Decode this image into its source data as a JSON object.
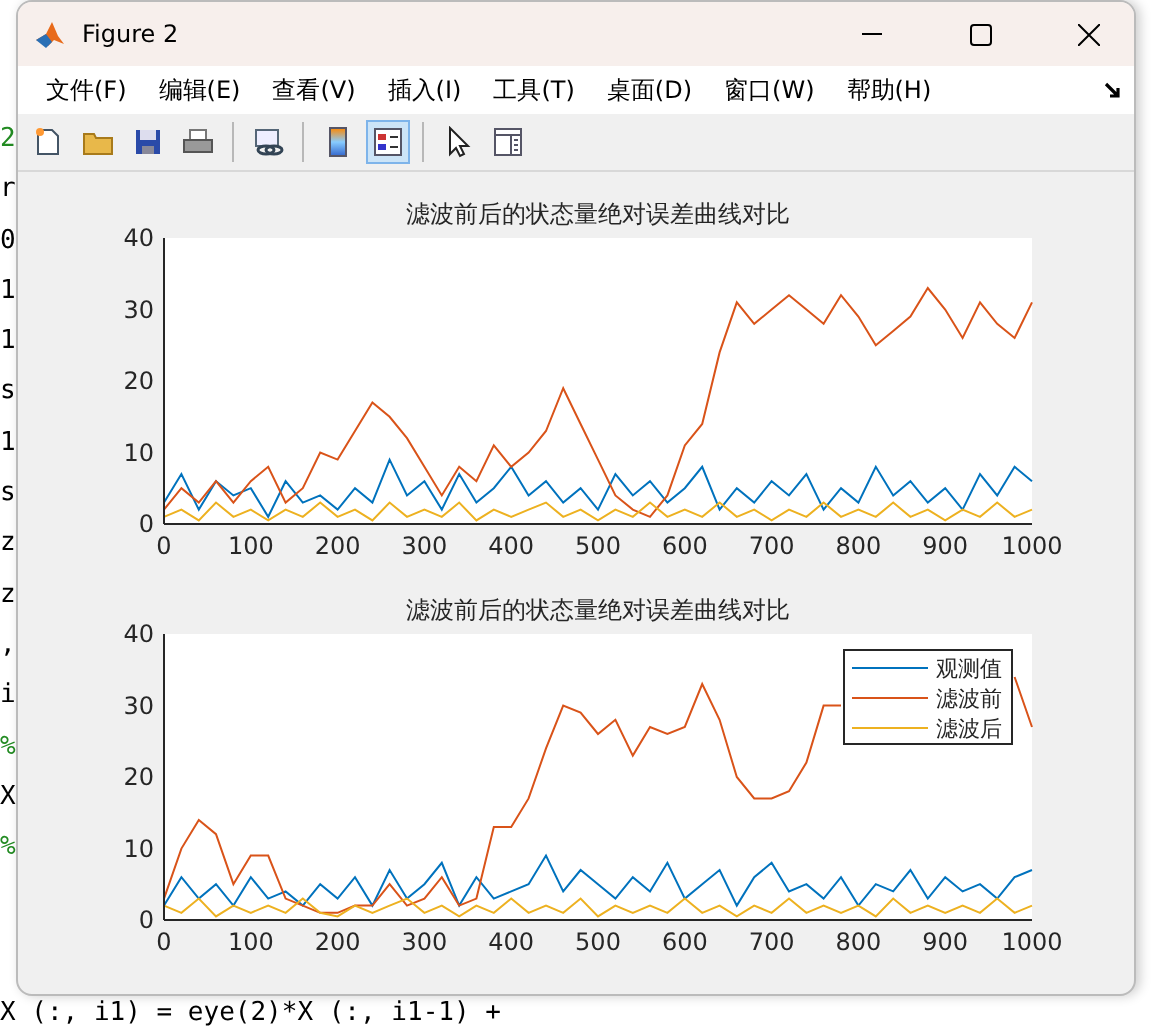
{
  "background_editor": {
    "left_lines": [
      {
        "text": "2",
        "kind": "comment"
      },
      {
        "text": "r",
        "kind": "code"
      },
      {
        "text": "0",
        "kind": "code"
      },
      {
        "text": "1",
        "kind": "code"
      },
      {
        "text": "1",
        "kind": "code"
      },
      {
        "text": "s",
        "kind": "code"
      },
      {
        "text": "1",
        "kind": "code"
      },
      {
        "text": "s",
        "kind": "code"
      },
      {
        "text": "z",
        "kind": "code"
      },
      {
        "text": "z",
        "kind": "code"
      },
      {
        "text": ",",
        "kind": "code"
      },
      {
        "text": "i",
        "kind": "code"
      },
      {
        "text": "%",
        "kind": "comment"
      },
      {
        "text": "X",
        "kind": "code"
      },
      {
        "text": "%",
        "kind": "comment"
      }
    ],
    "bottom_line": "X (:, i1) = eye(2)*X (:, i1-1) +"
  },
  "window": {
    "title": "Figure 2"
  },
  "menu": [
    "文件(F)",
    "编辑(E)",
    "查看(V)",
    "插入(I)",
    "工具(T)",
    "桌面(D)",
    "窗口(W)",
    "帮助(H)"
  ],
  "toolbar_buttons": [
    {
      "on": false
    },
    {
      "on": false
    },
    {
      "on": false
    },
    {
      "on": false
    },
    {
      "on": false
    },
    {
      "on": false
    },
    {
      "on": true
    },
    {
      "on": false
    },
    {
      "on": false
    }
  ],
  "axes": [
    {
      "chart_data": {
        "type": "line",
        "title": "滤波前后的状态量绝对误差曲线对比",
        "x": [
          0,
          20,
          40,
          60,
          80,
          100,
          120,
          140,
          160,
          180,
          200,
          220,
          240,
          260,
          280,
          300,
          320,
          340,
          360,
          380,
          400,
          420,
          440,
          460,
          480,
          500,
          520,
          540,
          560,
          580,
          600,
          620,
          640,
          660,
          680,
          700,
          720,
          740,
          760,
          780,
          800,
          820,
          840,
          860,
          880,
          900,
          920,
          940,
          960,
          980,
          1000
        ],
        "xlim": [
          0,
          1000
        ],
        "ylim": [
          0,
          40
        ],
        "xticks": [
          0,
          100,
          200,
          300,
          400,
          500,
          600,
          700,
          800,
          900,
          1000
        ],
        "yticks": [
          0,
          10,
          20,
          30,
          40
        ],
        "series": [
          {
            "color": "#0072bd",
            "values": [
              3,
              7,
              2,
              6,
              4,
              5,
              1,
              6,
              3,
              4,
              2,
              5,
              3,
              9,
              4,
              6,
              2,
              7,
              3,
              5,
              8,
              4,
              6,
              3,
              5,
              2,
              7,
              4,
              6,
              3,
              5,
              8,
              2,
              5,
              3,
              6,
              4,
              7,
              2,
              5,
              3,
              8,
              4,
              6,
              3,
              5,
              2,
              7,
              4,
              8,
              6
            ]
          },
          {
            "color": "#d95319",
            "values": [
              2,
              5,
              3,
              6,
              3,
              6,
              8,
              3,
              5,
              10,
              9,
              13,
              17,
              15,
              12,
              8,
              4,
              8,
              6,
              11,
              8,
              10,
              13,
              19,
              14,
              9,
              4,
              2,
              1,
              4,
              11,
              14,
              24,
              31,
              28,
              30,
              32,
              30,
              28,
              32,
              29,
              25,
              27,
              29,
              33,
              30,
              26,
              31,
              28,
              26,
              31
            ]
          },
          {
            "color": "#edb120",
            "values": [
              1,
              2,
              0.5,
              3,
              1,
              2,
              0.5,
              2,
              1,
              3,
              1,
              2,
              0.5,
              3,
              1,
              2,
              1,
              3,
              0.5,
              2,
              1,
              2,
              3,
              1,
              2,
              0.5,
              2,
              1,
              3,
              1,
              2,
              1,
              3,
              1,
              2,
              0.5,
              2,
              1,
              3,
              1,
              2,
              1,
              3,
              1,
              2,
              0.5,
              2,
              1,
              3,
              1,
              2
            ]
          }
        ]
      }
    },
    {
      "chart_data": {
        "type": "line",
        "title": "滤波前后的状态量绝对误差曲线对比",
        "legend": "upper right",
        "x": [
          0,
          20,
          40,
          60,
          80,
          100,
          120,
          140,
          160,
          180,
          200,
          220,
          240,
          260,
          280,
          300,
          320,
          340,
          360,
          380,
          400,
          420,
          440,
          460,
          480,
          500,
          520,
          540,
          560,
          580,
          600,
          620,
          640,
          660,
          680,
          700,
          720,
          740,
          760,
          780,
          800,
          820,
          840,
          860,
          880,
          900,
          920,
          940,
          960,
          980,
          1000
        ],
        "xlim": [
          0,
          1000
        ],
        "ylim": [
          0,
          40
        ],
        "xticks": [
          0,
          100,
          200,
          300,
          400,
          500,
          600,
          700,
          800,
          900,
          1000
        ],
        "yticks": [
          0,
          10,
          20,
          30,
          40
        ],
        "series": [
          {
            "name": "观测值",
            "color": "#0072bd",
            "values": [
              2,
              6,
              3,
              5,
              2,
              6,
              3,
              4,
              2,
              5,
              3,
              6,
              2,
              7,
              3,
              5,
              8,
              2,
              6,
              3,
              4,
              5,
              9,
              4,
              7,
              5,
              3,
              6,
              4,
              8,
              3,
              5,
              7,
              2,
              6,
              8,
              4,
              5,
              3,
              6,
              2,
              5,
              4,
              7,
              3,
              6,
              4,
              5,
              3,
              6,
              7
            ]
          },
          {
            "name": "滤波前",
            "color": "#d95319",
            "values": [
              3,
              10,
              14,
              12,
              5,
              9,
              9,
              3,
              2,
              1,
              1,
              2,
              2,
              5,
              2,
              3,
              6,
              2,
              3,
              13,
              13,
              17,
              24,
              30,
              29,
              26,
              28,
              23,
              27,
              26,
              27,
              33,
              28,
              20,
              17,
              17,
              18,
              22,
              30,
              30,
              null,
              null,
              null,
              null,
              null,
              null,
              null,
              null,
              null,
              34,
              27
            ]
          },
          {
            "name": "滤波后",
            "color": "#edb120",
            "values": [
              2,
              1,
              3,
              0.5,
              2,
              1,
              2,
              1,
              3,
              1,
              0.5,
              2,
              1,
              2,
              3,
              1,
              2,
              0.5,
              2,
              1,
              3,
              1,
              2,
              1,
              3,
              0.5,
              2,
              1,
              2,
              1,
              3,
              1,
              2,
              0.5,
              2,
              1,
              3,
              1,
              2,
              1,
              2,
              0.5,
              3,
              1,
              2,
              1,
              2,
              1,
              3,
              1,
              2
            ]
          }
        ]
      }
    }
  ]
}
